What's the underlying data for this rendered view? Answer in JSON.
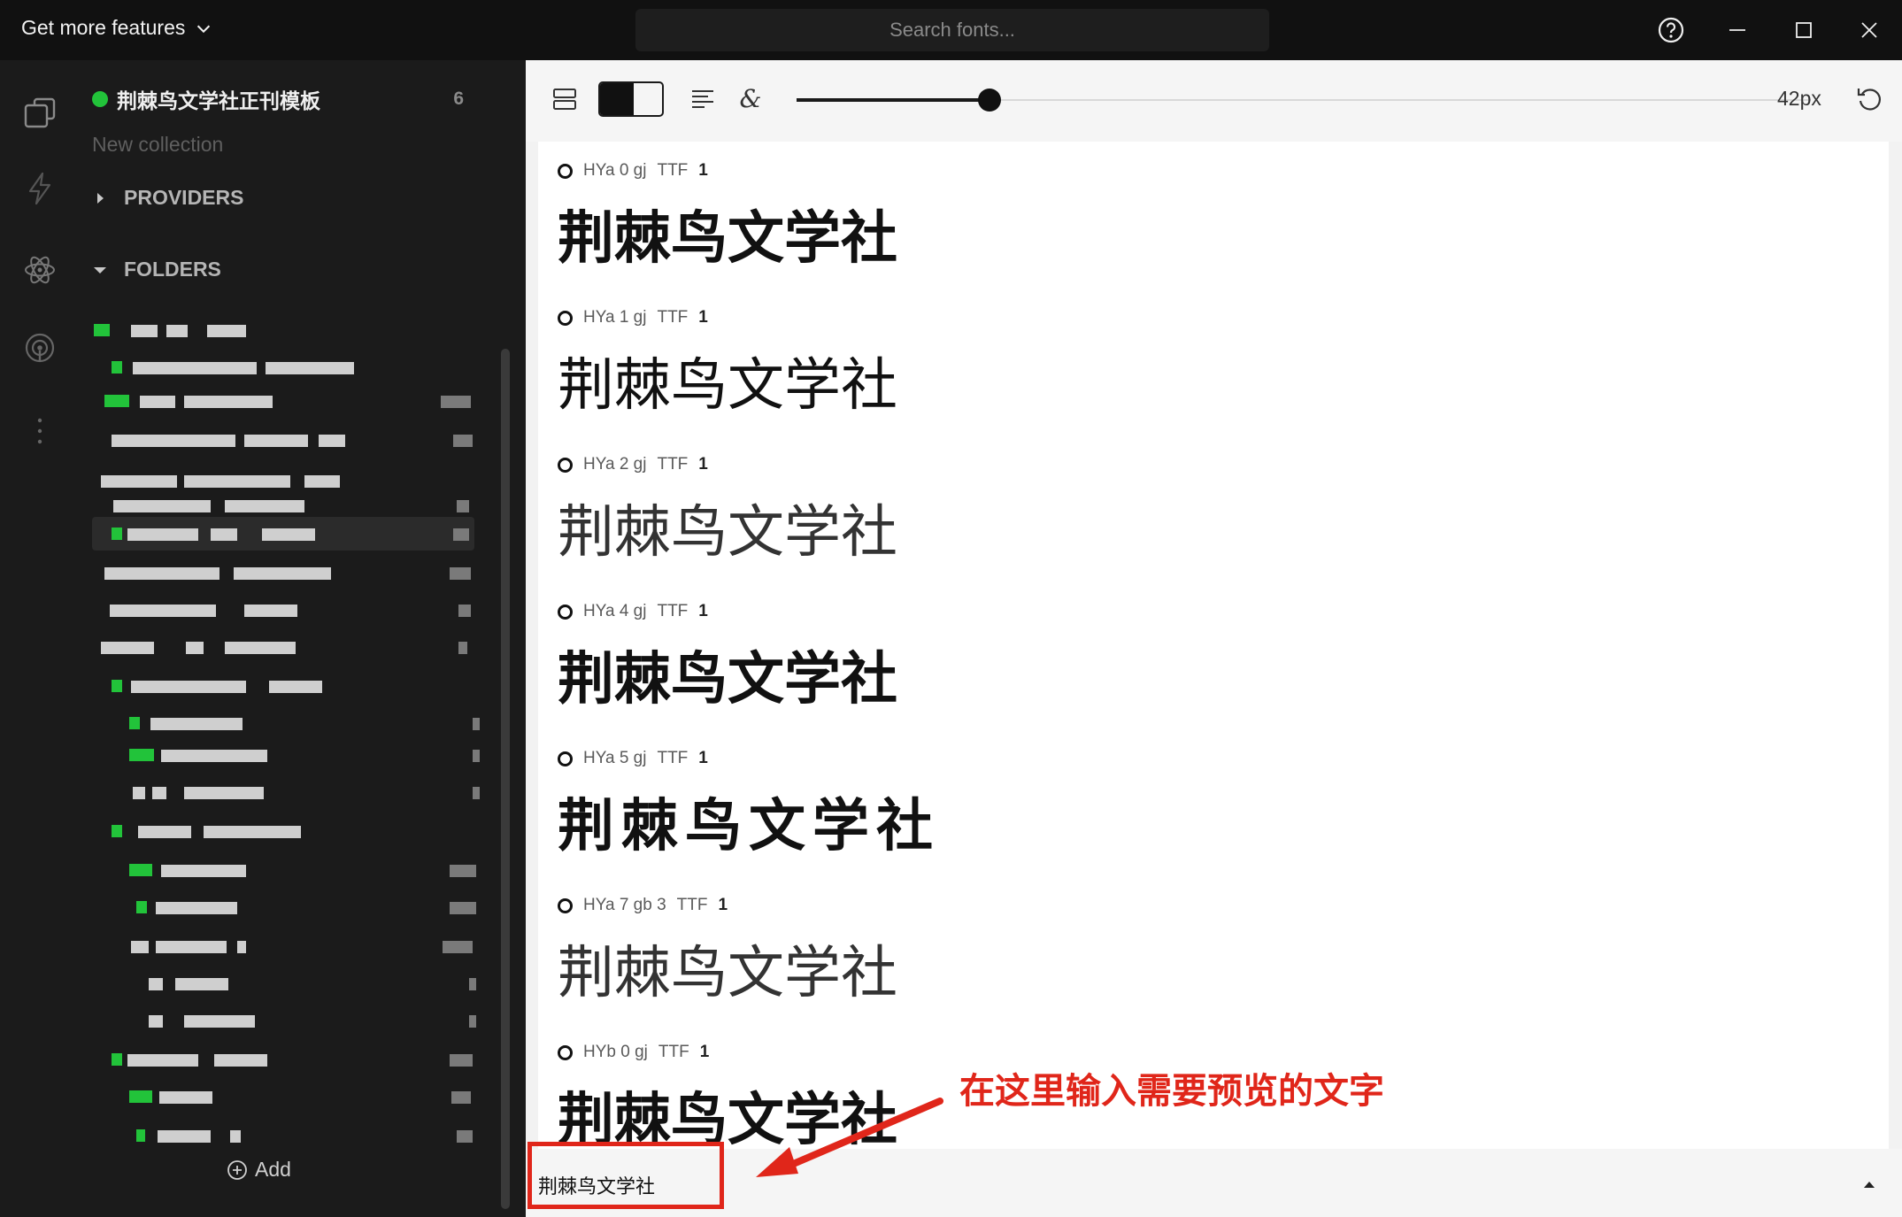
{
  "titlebar": {
    "get_more_label": "Get more features",
    "search_placeholder": "Search fonts...",
    "icons": [
      "help-icon",
      "minimize-icon",
      "maximize-icon",
      "close-icon"
    ]
  },
  "rail": {
    "icons": [
      "collections-icon",
      "flash-icon",
      "atom-icon",
      "broadcast-icon",
      "more-vertical-icon"
    ]
  },
  "sidebar": {
    "collection": {
      "name": "荆棘鸟文学社正刊模板",
      "count": "6",
      "dot_color": "#22c33a"
    },
    "new_collection_label": "New collection",
    "providers_label": "PROVIDERS",
    "folders_label": "FOLDERS",
    "add_label": "Add"
  },
  "toolbar": {
    "size_value": "42px",
    "size_fraction": 0.19,
    "icons": [
      "layout-icon",
      "theme-toggle-icon",
      "align-left-icon",
      "ampersand-icon",
      "reset-icon"
    ]
  },
  "fonts": [
    {
      "name": "HYa 0 gj",
      "format": "TTF",
      "count": "1",
      "weight": "900",
      "spacing": "0px"
    },
    {
      "name": "HYa 1 gj",
      "format": "TTF",
      "count": "1",
      "weight": "400",
      "spacing": "0px"
    },
    {
      "name": "HYa 2 gj",
      "format": "TTF",
      "count": "1",
      "weight": "200",
      "spacing": "0px"
    },
    {
      "name": "HYa 4 gj",
      "format": "TTF",
      "count": "1",
      "weight": "900",
      "spacing": "0px"
    },
    {
      "name": "HYa 5 gj",
      "format": "TTF",
      "count": "1",
      "weight": "700",
      "spacing": "8px"
    },
    {
      "name": "HYa 7 gb 3",
      "format": "TTF",
      "count": "1",
      "weight": "200",
      "spacing": "0px"
    },
    {
      "name": "HYb 0 gj",
      "format": "TTF",
      "count": "1",
      "weight": "900",
      "spacing": "0px"
    }
  ],
  "preview_text": "荆棘鸟文学社",
  "annotation": {
    "text": "在这里输入需要预览的文字",
    "color": "#e0261a"
  }
}
